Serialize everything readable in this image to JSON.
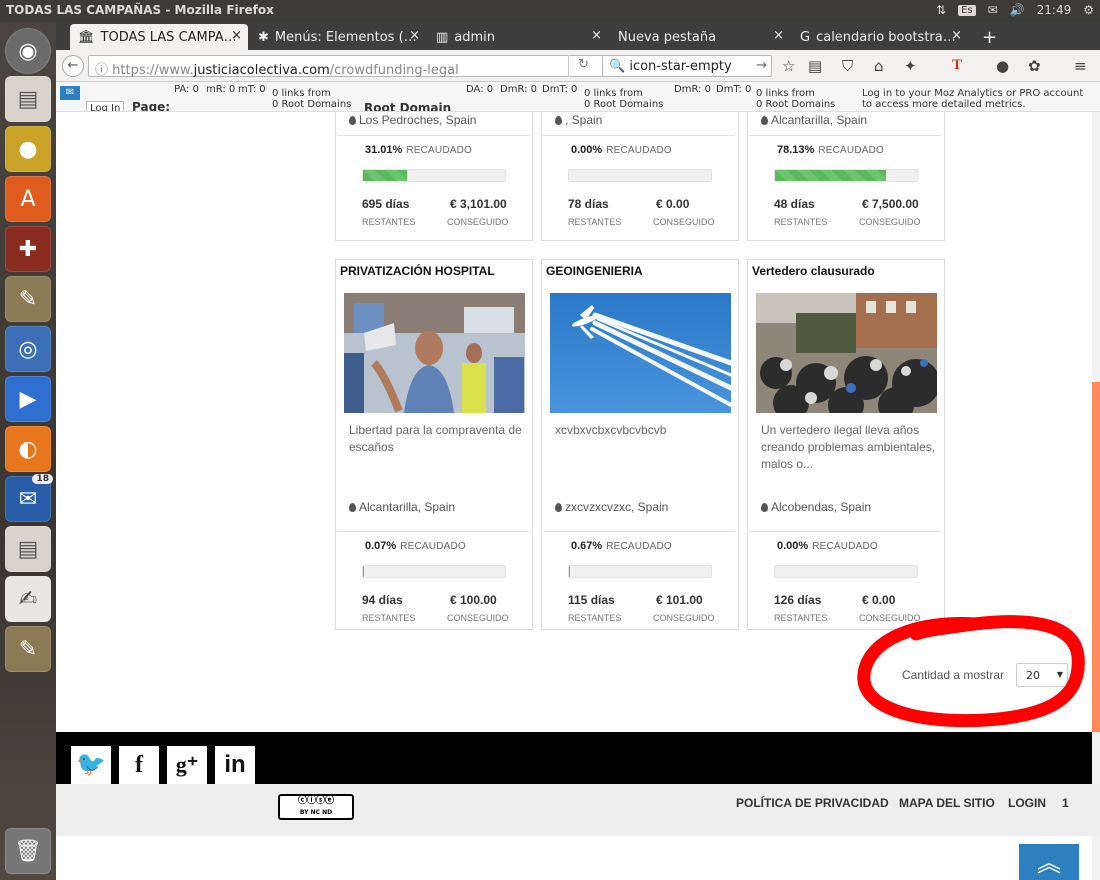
{
  "os": {
    "window_title": "TODAS LAS CAMPAÑAS - Mozilla Firefox",
    "keyboard": "Es",
    "clock": "21:49",
    "launcher_badge": "18"
  },
  "browser": {
    "tabs": [
      {
        "label": "TODAS LAS CAMPA…"
      },
      {
        "label": "Menús: Elementos (…"
      },
      {
        "label": "admin"
      },
      {
        "label": "Nueva pestaña"
      },
      {
        "label": "calendario bootstra…"
      }
    ],
    "url_prefix": "https://www.",
    "url_host": "justiciacolectiva.com",
    "url_path": "/crowdfunding-legal",
    "search_value": "icon-star-empty"
  },
  "mozbar": {
    "login_btn": "Log In",
    "page_label": "Page:",
    "pa": "PA: 0",
    "mr": "mR: 0",
    "mt": "mT: 0",
    "links_from_1": "0 links from",
    "root_domains_1": "0 Root Domains",
    "root_domain_label": "Root Domain",
    "da": "DA: 0",
    "dmr": "DmR: 0",
    "dmt": "DmT: 0",
    "links_from_2": "0 links from",
    "root_domains_2": "0 Root Domains",
    "dmr2": "DmR: 0",
    "dmt2": "DmT: 0",
    "links_from_3": "0 links from",
    "root_domains_3": "0 Root Domains",
    "pro_msg_1": "Log in to your Moz Analytics or PRO account",
    "pro_msg_2": "to access more detailed metrics."
  },
  "labels": {
    "raised": "RECAUDADO",
    "remaining": "RESTANTES",
    "achieved": "CONSEGUIDO"
  },
  "campaigns_top": [
    {
      "location": "Los Pedroches, Spain",
      "percent": "31.01%",
      "progress": 0.31,
      "days": "695 días",
      "amount": "€ 3,101.00"
    },
    {
      "location": ", Spain",
      "percent": "0.00%",
      "progress": 0.0,
      "days": "78 días",
      "amount": "€ 0.00"
    },
    {
      "location": "Alcantarilla, Spain",
      "percent": "78.13%",
      "progress": 0.78,
      "days": "48 días",
      "amount": "€ 7,500.00"
    }
  ],
  "campaigns": [
    {
      "title": "PRIVATIZACIÓN HOSPITAL",
      "desc": "Libertad para la compraventa de escaños",
      "location": "Alcantarilla, Spain",
      "percent": "0.07%",
      "progress": 0.0007,
      "days": "94 días",
      "amount": "€ 100.00"
    },
    {
      "title": "GEOINGENIERIA",
      "desc": "xcvbxvcbxcvbcvbcvb",
      "location": "zxcvzxcvzxc, Spain",
      "percent": "0.67%",
      "progress": 0.0067,
      "days": "115 días",
      "amount": "€ 101.00"
    },
    {
      "title": "Vertedero clausurado",
      "desc": "Un vertedero ilegal lleva años creando problemas ambientales, malos o...",
      "location": "Alcobendas, Spain",
      "percent": "0.00%",
      "progress": 0.0,
      "days": "126 días",
      "amount": "€ 0.00"
    }
  ],
  "pagination": {
    "label": "Cantidad a mostrar",
    "selected": "20"
  },
  "footer": {
    "social": [
      "twitter-icon",
      "facebook-icon",
      "googleplus-icon",
      "linkedin-icon"
    ],
    "cc_text": "BY  NC  ND",
    "links": [
      "POLÍTICA DE PRIVACIDAD",
      "MAPA DEL SITIO",
      "LOGIN",
      "1"
    ]
  },
  "colors": {
    "progress": "#5cb85c",
    "to_top": "#2d7fc0",
    "annotation": "#ff0000"
  }
}
